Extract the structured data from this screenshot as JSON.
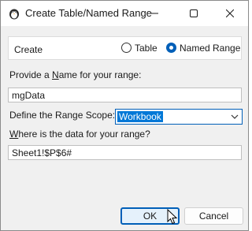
{
  "window": {
    "title": "Create Table/Named Range",
    "app_icon": "penguin-icon"
  },
  "titlebar_buttons": {
    "minimize_icon": "minimize-icon",
    "maximize_icon": "maximize-icon",
    "close_icon": "close-icon"
  },
  "create": {
    "label": "Create",
    "option_table": "Table",
    "option_named_range": "Named Range",
    "selected": "Named Range"
  },
  "name_field": {
    "label_pre": "Provide a ",
    "label_accel": "N",
    "label_post": "ame for your range:",
    "value": "mgData"
  },
  "scope": {
    "label": "Define the Range Scope:",
    "value": "Workbook"
  },
  "range_field": {
    "label_accel": "W",
    "label_post": "here is the data for your range?",
    "value": "Sheet1!$P$6#"
  },
  "buttons": {
    "ok": "OK",
    "cancel": "Cancel"
  },
  "colors": {
    "accent": "#005fb8",
    "selection": "#0078d7"
  }
}
